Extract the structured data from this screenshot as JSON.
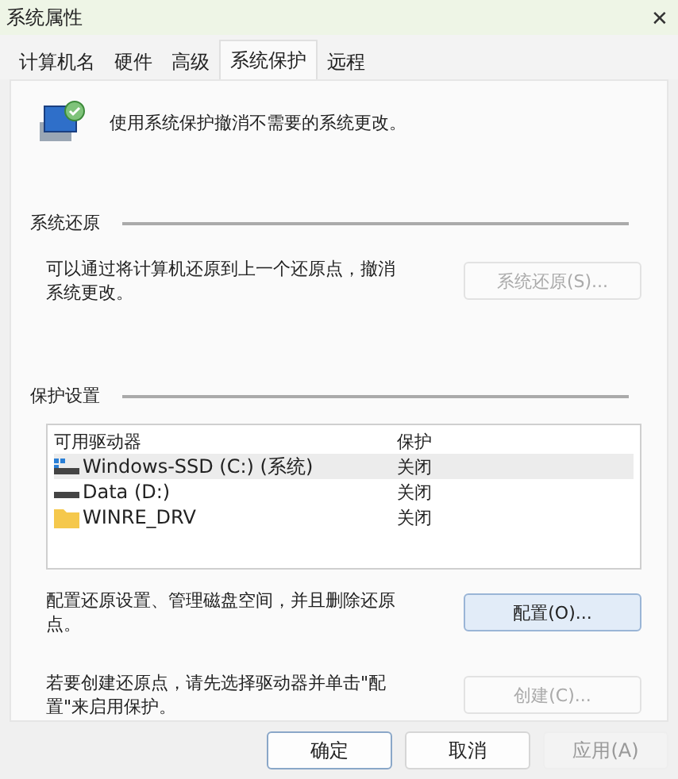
{
  "window": {
    "title": "系统属性",
    "close": "✕"
  },
  "tabs": [
    {
      "label": "计算机名",
      "selected": false
    },
    {
      "label": "硬件",
      "selected": false
    },
    {
      "label": "高级",
      "selected": false
    },
    {
      "label": "系统保护",
      "selected": true
    },
    {
      "label": "远程",
      "selected": false
    }
  ],
  "intro": "使用系统保护撤消不需要的系统更改。",
  "restore": {
    "heading": "系统还原",
    "text": "可以通过将计算机还原到上一个还原点，撤消系统更改。",
    "button": {
      "label": "系统还原(S)...",
      "disabled": true
    }
  },
  "protection": {
    "heading": "保护设置",
    "columns": [
      "可用驱动器",
      "保护"
    ],
    "rows": [
      {
        "kind": "system-drive",
        "name": "Windows-SSD (C:) (系统)",
        "status": "关闭",
        "selected": true
      },
      {
        "kind": "drive",
        "name": "Data (D:)",
        "status": "关闭",
        "selected": false
      },
      {
        "kind": "folder",
        "name": "WINRE_DRV",
        "status": "关闭",
        "selected": false
      }
    ],
    "configure": {
      "text": "配置还原设置、管理磁盘空间，并且删除还原点。",
      "button": {
        "label": "配置(O)...",
        "disabled": false
      }
    },
    "create": {
      "text": "若要创建还原点，请先选择驱动器并单击\"配置\"来启用保护。",
      "button": {
        "label": "创建(C)...",
        "disabled": true
      }
    }
  },
  "buttons": [
    {
      "label": "确定",
      "disabled": false,
      "default": true
    },
    {
      "label": "取消",
      "disabled": false,
      "default": false
    },
    {
      "label": "应用(A)",
      "disabled": true,
      "default": false
    }
  ]
}
